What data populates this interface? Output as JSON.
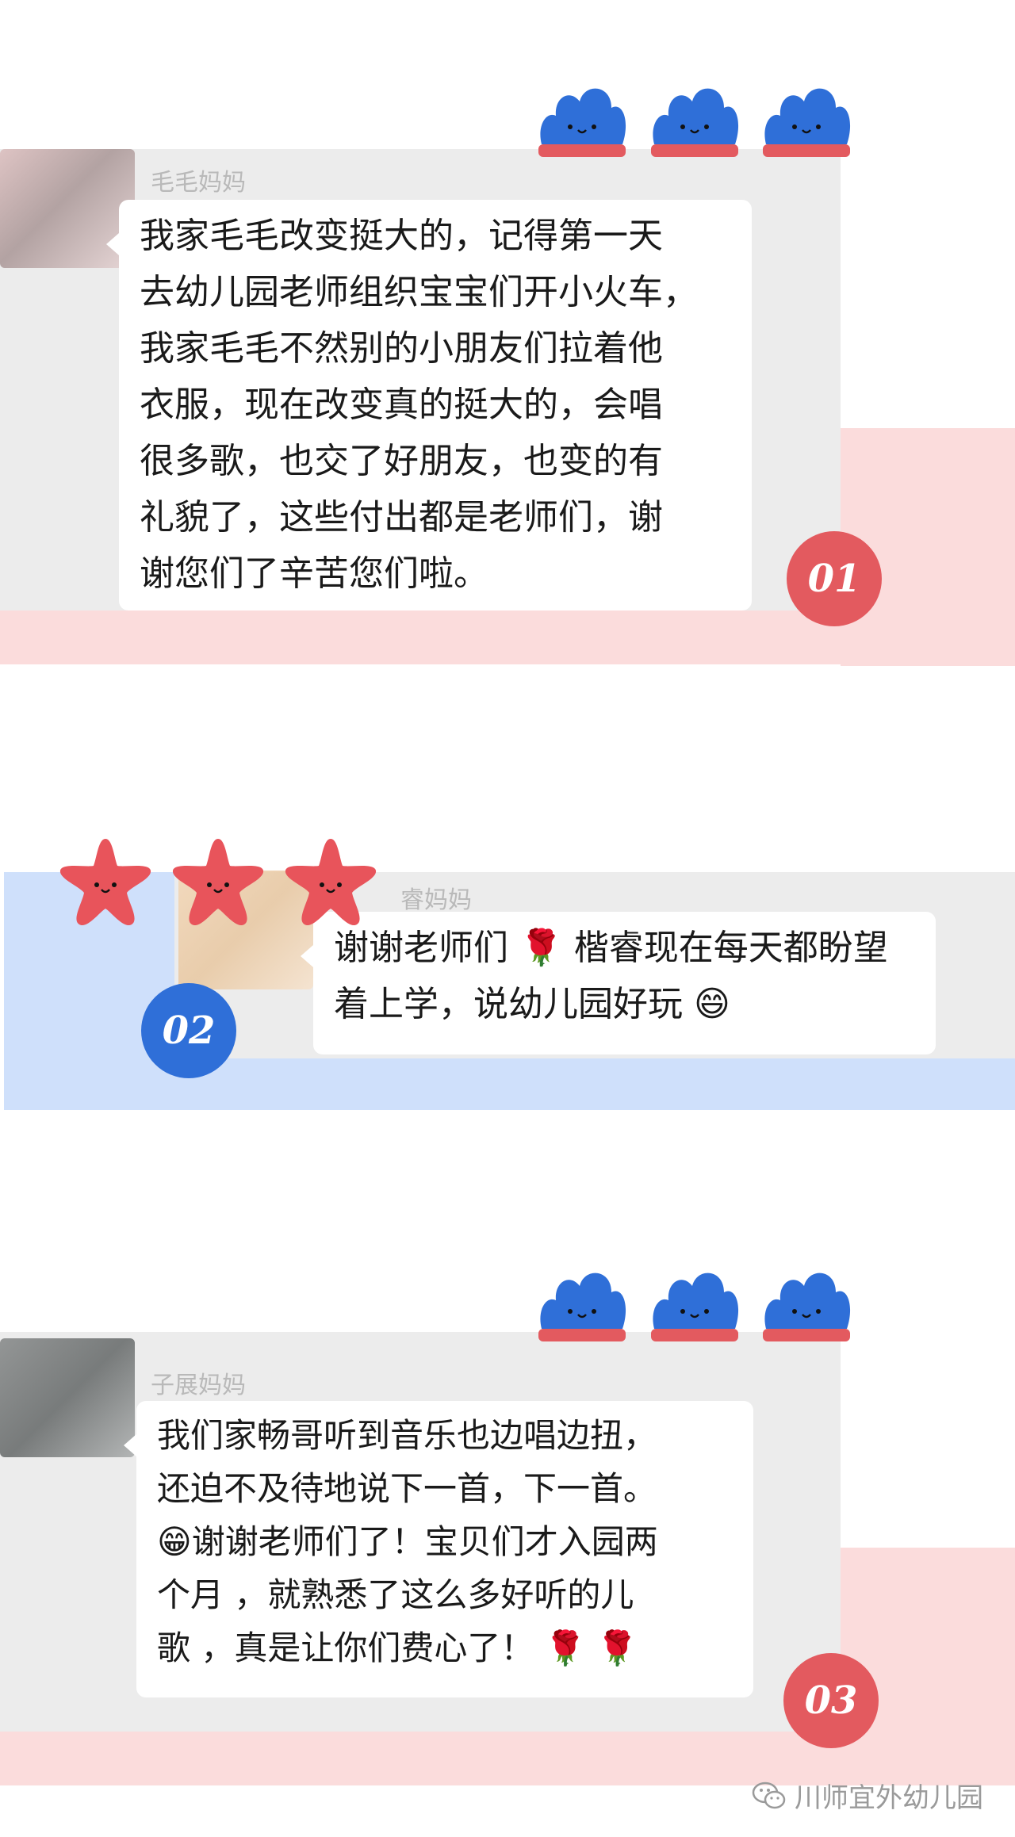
{
  "colors": {
    "pink": "#fbdcdc",
    "blue_light": "#cfe0fb",
    "card_gray": "#ececec",
    "badge_red": "#e35a5f",
    "badge_blue": "#2f6fd8",
    "blob_blue": "#2f6fd8",
    "blob_red": "#e35a5f",
    "star_red": "#e8545b"
  },
  "messages": [
    {
      "badge": "01",
      "sender": "毛毛妈妈",
      "lines": [
        "我家毛毛改变挺大的，记得第一天",
        "去幼儿园老师组织宝宝们开小火车，",
        "我家毛毛不然别的小朋友们拉着他",
        "衣服，现在改变真的挺大的，会唱",
        "很多歌，也交了好朋友，也变的有",
        "礼貌了，这些付出都是老师们，谢",
        "谢您们了辛苦您们啦。"
      ]
    },
    {
      "badge": "02",
      "sender": "睿妈妈",
      "lines": [
        "谢谢老师们 🌹 楷睿现在每天都盼望",
        "着上学，说幼儿园好玩 😄"
      ]
    },
    {
      "badge": "03",
      "sender": "子展妈妈",
      "lines": [
        "我们家畅哥听到音乐也边唱边扭，",
        "还迫不及待地说下一首，下一首。",
        "😁谢谢老师们了！宝贝们才入园两",
        "个月 ，就熟悉了这么多好听的儿",
        "歌 ，真是让你们费心了！ 🌹 🌹"
      ]
    }
  ],
  "watermark": {
    "icon": "wechat-icon",
    "text": "川师宜外幼儿园"
  }
}
